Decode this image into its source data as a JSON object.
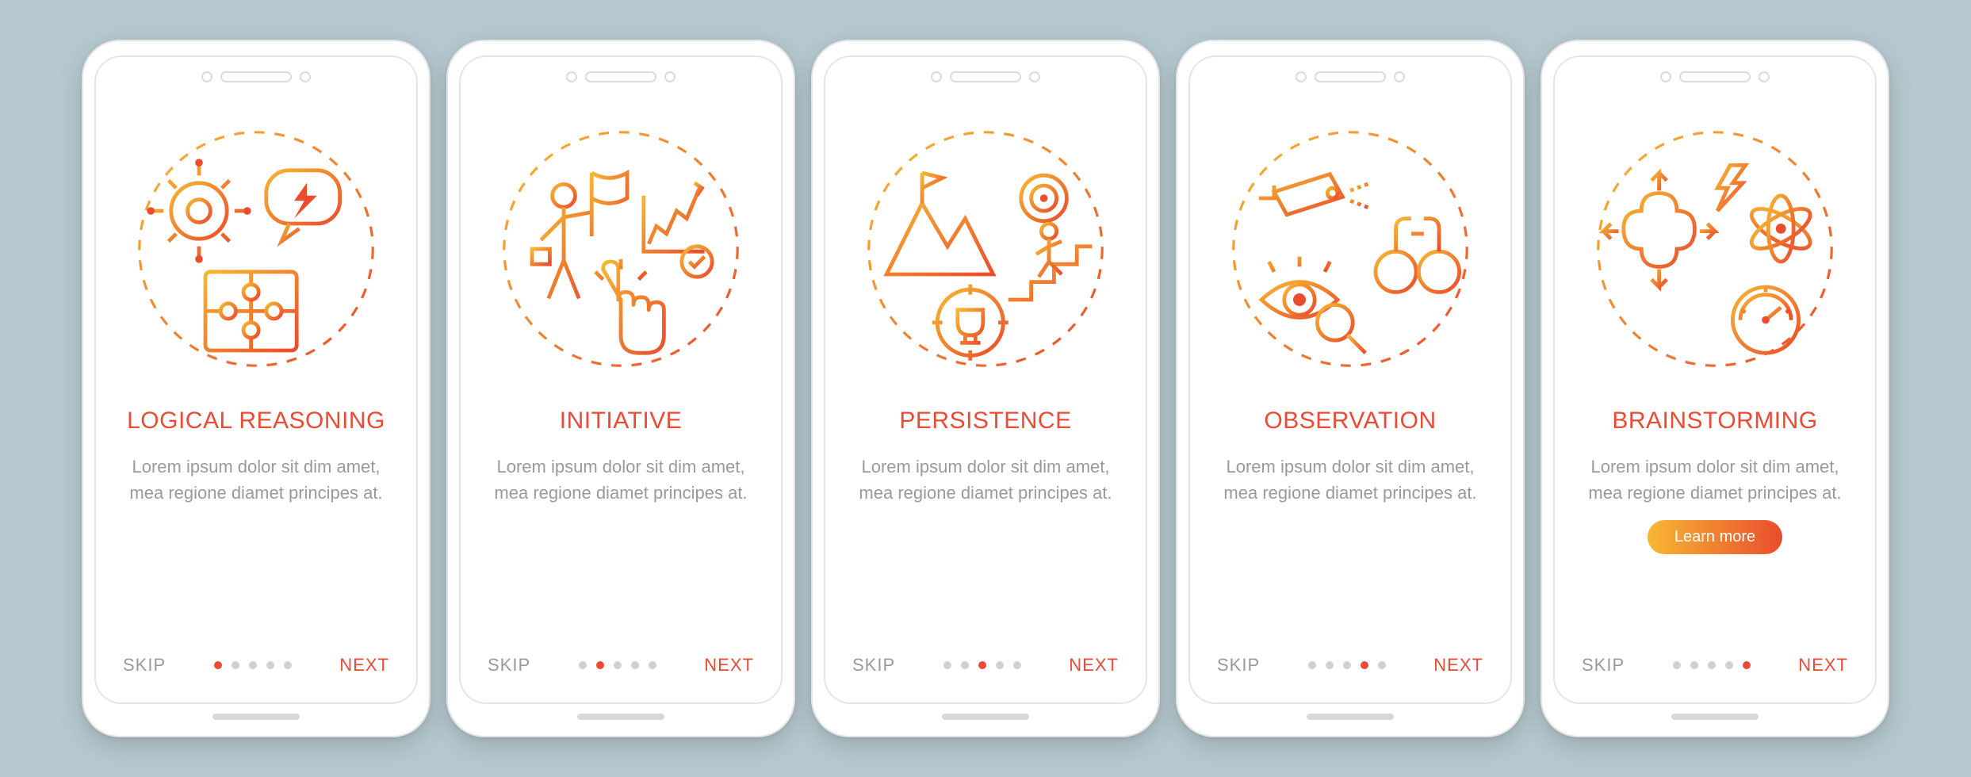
{
  "common_skip": "SKIP",
  "common_next": "NEXT",
  "learn_more": "Learn more",
  "total_pages": 5,
  "accent": "#e94b35",
  "gradient_start": "#f7b733",
  "gradient_end": "#ea4c2d",
  "screens": [
    {
      "title": "Logical reasoning",
      "desc": "Lorem ipsum dolor sit dim amet, mea regione diamet principes at.",
      "active_index": 0,
      "has_button": false
    },
    {
      "title": "Initiative",
      "desc": "Lorem ipsum dolor sit dim amet, mea regione diamet principes at.",
      "active_index": 1,
      "has_button": false
    },
    {
      "title": "Persistence",
      "desc": "Lorem ipsum dolor sit dim amet, mea regione diamet principes at.",
      "active_index": 2,
      "has_button": false
    },
    {
      "title": "Observation",
      "desc": "Lorem ipsum dolor sit dim amet, mea regione diamet principes at.",
      "active_index": 3,
      "has_button": false
    },
    {
      "title": "Brainstorming",
      "desc": "Lorem ipsum dolor sit dim amet, mea regione diamet principes at.",
      "active_index": 4,
      "has_button": true
    }
  ]
}
